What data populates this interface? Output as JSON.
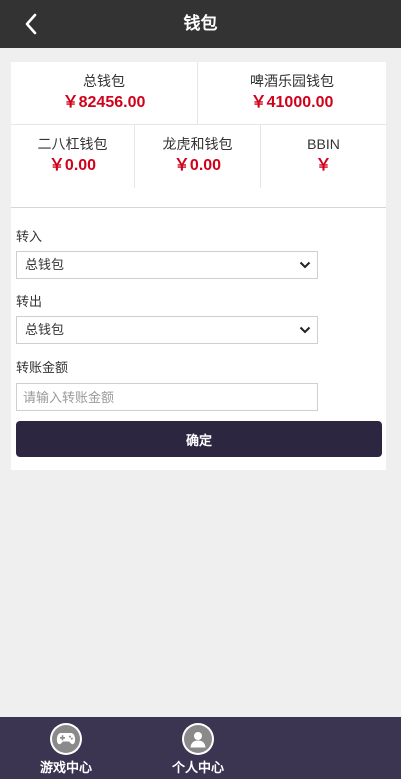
{
  "header": {
    "title": "钱包",
    "back_icon": "chevron-left-icon"
  },
  "wallets": {
    "total": {
      "name": "总钱包",
      "amount": "￥82456.00"
    },
    "beer_park": {
      "name": "啤酒乐园钱包",
      "amount": "￥41000.00"
    },
    "erbagang": {
      "name": "二八杠钱包",
      "amount": "￥0.00"
    },
    "longhuhe": {
      "name": "龙虎和钱包",
      "amount": "￥0.00"
    },
    "bbin": {
      "name": "BBIN",
      "amount": "￥"
    }
  },
  "form": {
    "transfer_in_label": "转入",
    "transfer_in_value": "总钱包",
    "transfer_out_label": "转出",
    "transfer_out_value": "总钱包",
    "amount_label": "转账金额",
    "amount_value": "",
    "amount_placeholder": "请输入转账金额",
    "confirm_label": "确定"
  },
  "tabbar": {
    "games": {
      "label": "游戏中心",
      "icon": "gamepad-icon"
    },
    "profile": {
      "label": "个人中心",
      "icon": "user-icon"
    }
  },
  "colors": {
    "header_bg": "#333333",
    "amount_red": "#d0021b",
    "button_bg": "#2d2640",
    "tabbar_bg": "#3b3551",
    "page_bg": "#efefef"
  }
}
